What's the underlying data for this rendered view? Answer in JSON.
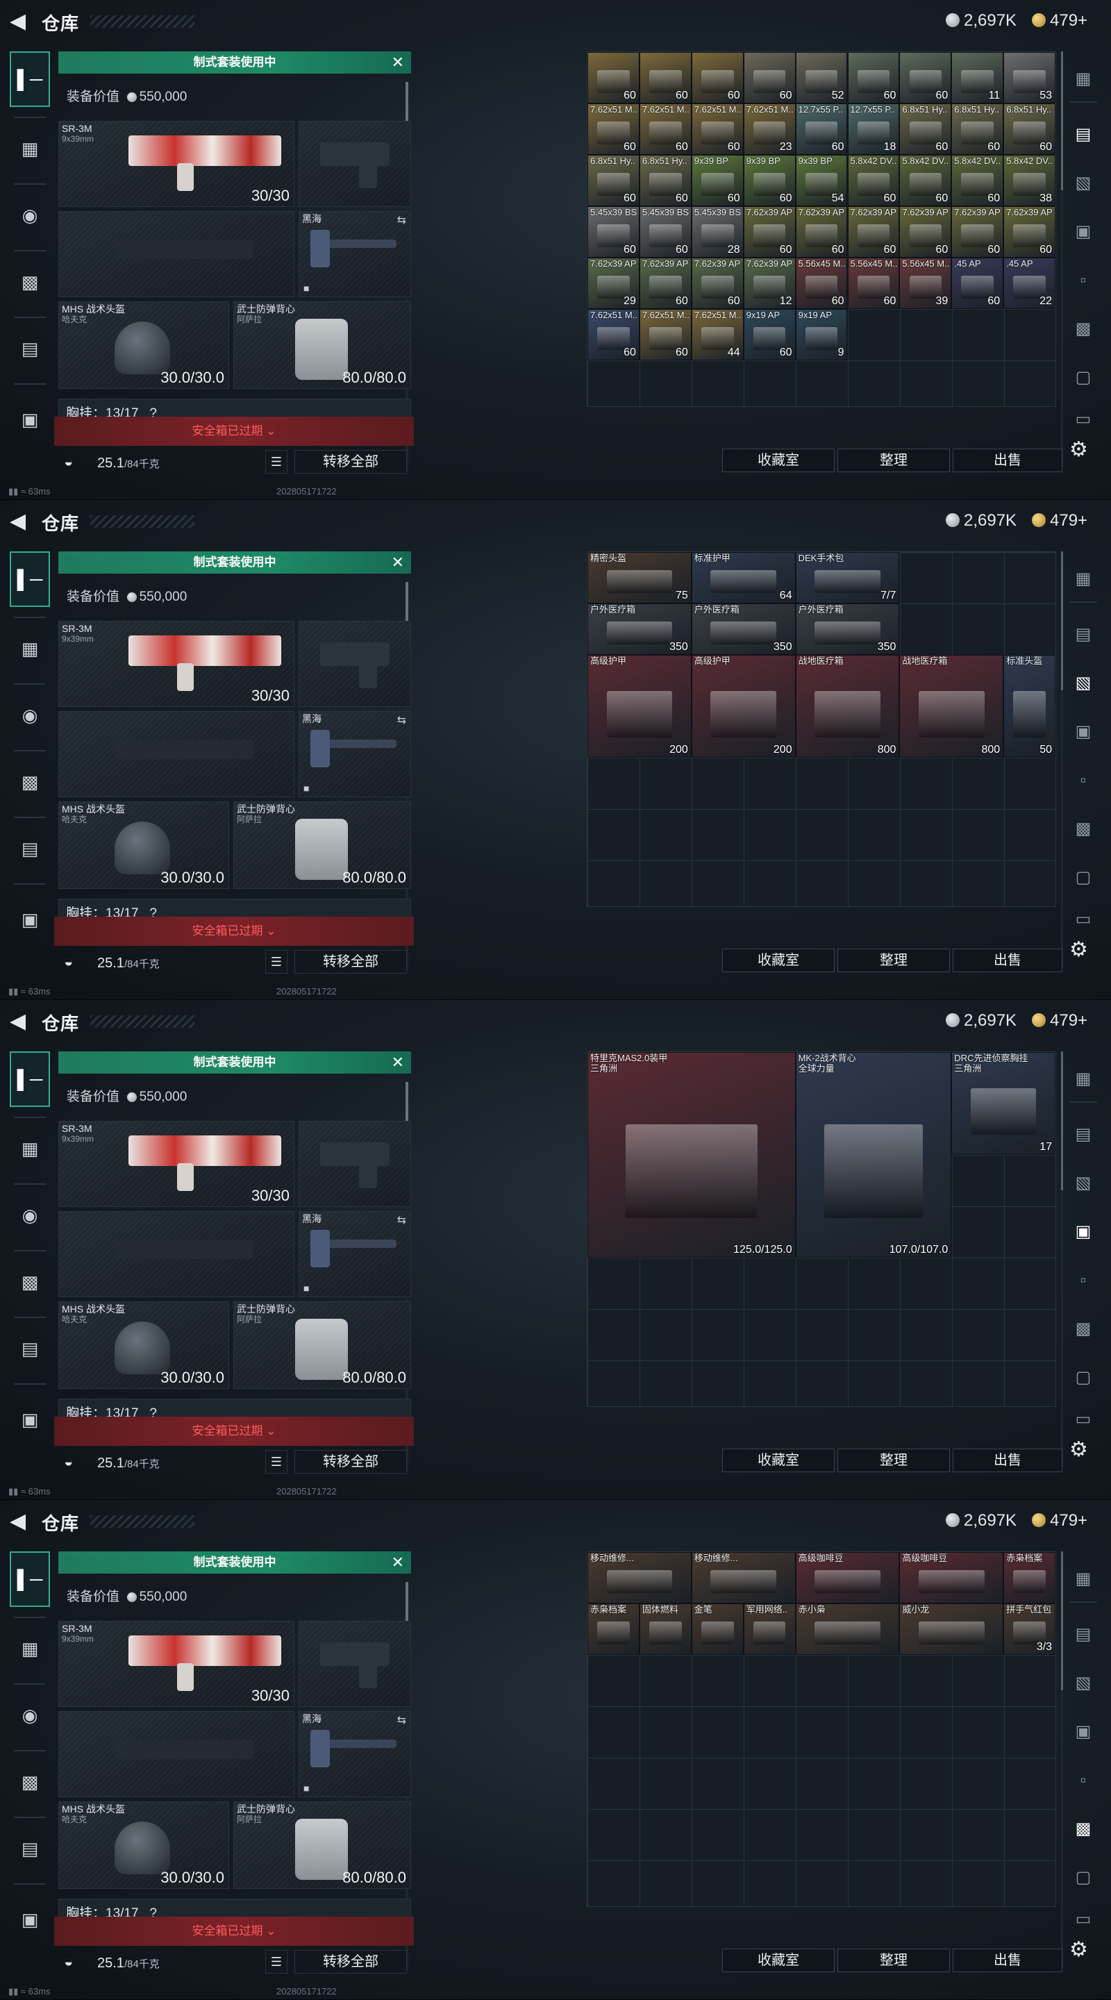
{
  "header": {
    "title": "仓库",
    "silver": "2,697K",
    "gold": "479+",
    "silver_color": "#b9bfc5",
    "gold_color": "#d9b24a"
  },
  "loadout": {
    "banner": "制式套装使用中",
    "equip_value_label": "装备价值",
    "equip_value": "550,000",
    "primary": {
      "name": "SR-3M",
      "caliber": "9x39mm",
      "ammo": "30/30"
    },
    "melee": {
      "name": "黑海"
    },
    "helmet": {
      "name": "MHS 战术头盔",
      "sub": "哈夫克",
      "dur": "30.0/30.0"
    },
    "armor": {
      "name": "武士防弹背心",
      "sub": "阿萨拉",
      "dur": "80.0/80.0"
    },
    "chest": {
      "label": "胸挂：13/17",
      "q": "?"
    },
    "safebox": "安全箱已过期",
    "weight": "25.1",
    "weight_cap": "/84千克",
    "transfer": "转移全部"
  },
  "actions": {
    "collection": "收藏室",
    "sort": "整理",
    "sell": "出售"
  },
  "status": {
    "ping": "63ms",
    "build": "202805171722"
  },
  "icons": {
    "back": "back-arrow-icon",
    "weapon": "gun-icon",
    "armor": "vest-icon",
    "helmet": "helmet-icon",
    "bag": "backpack-icon",
    "pouch": "pouch-icon",
    "case": "case-icon",
    "lock": "lock-icon",
    "list": "list-icon",
    "gear": "gear-icon"
  },
  "panels": [
    {
      "items": [
        {
          "c": 0,
          "r": 0,
          "w": 1,
          "h": 1,
          "name": "",
          "count": "60",
          "color": "#7d6a3a"
        },
        {
          "c": 1,
          "r": 0,
          "w": 1,
          "h": 1,
          "name": "",
          "count": "60",
          "color": "#7d6a3a"
        },
        {
          "c": 2,
          "r": 0,
          "w": 1,
          "h": 1,
          "name": "",
          "count": "60",
          "color": "#7d6a3a"
        },
        {
          "c": 3,
          "r": 0,
          "w": 1,
          "h": 1,
          "name": "",
          "count": "60",
          "color": "#6e6a5a"
        },
        {
          "c": 4,
          "r": 0,
          "w": 1,
          "h": 1,
          "name": "",
          "count": "52",
          "color": "#6e6a5a"
        },
        {
          "c": 5,
          "r": 0,
          "w": 1,
          "h": 1,
          "name": "",
          "count": "60",
          "color": "#5e6a5a"
        },
        {
          "c": 6,
          "r": 0,
          "w": 1,
          "h": 1,
          "name": "",
          "count": "60",
          "color": "#5e6a5a"
        },
        {
          "c": 7,
          "r": 0,
          "w": 1,
          "h": 1,
          "name": "",
          "count": "11",
          "color": "#5e6a5a"
        },
        {
          "c": 8,
          "r": 0,
          "w": 1,
          "h": 1,
          "name": "",
          "count": "53",
          "color": "#6e6e6e"
        },
        {
          "c": 0,
          "r": 1,
          "w": 1,
          "h": 1,
          "name": "7.62x51 M..",
          "count": "60",
          "color": "#7d6a3a"
        },
        {
          "c": 1,
          "r": 1,
          "w": 1,
          "h": 1,
          "name": "7.62x51 M..",
          "count": "60",
          "color": "#7d6a3a"
        },
        {
          "c": 2,
          "r": 1,
          "w": 1,
          "h": 1,
          "name": "7.62x51 M..",
          "count": "60",
          "color": "#7d6a3a"
        },
        {
          "c": 3,
          "r": 1,
          "w": 1,
          "h": 1,
          "name": "7.62x51 M..",
          "count": "23",
          "color": "#7d6a3a"
        },
        {
          "c": 4,
          "r": 1,
          "w": 1,
          "h": 1,
          "name": "12.7x55 P..",
          "count": "60",
          "color": "#4f6a6a"
        },
        {
          "c": 5,
          "r": 1,
          "w": 1,
          "h": 1,
          "name": "12.7x55 P..",
          "count": "18",
          "color": "#4f6a6a"
        },
        {
          "c": 6,
          "r": 1,
          "w": 1,
          "h": 1,
          "name": "6.8x51 Hy..",
          "count": "60",
          "color": "#6e6a4a"
        },
        {
          "c": 7,
          "r": 1,
          "w": 1,
          "h": 1,
          "name": "6.8x51 Hy..",
          "count": "60",
          "color": "#6e6a4a"
        },
        {
          "c": 8,
          "r": 1,
          "w": 1,
          "h": 1,
          "name": "6.8x51 Hy..",
          "count": "60",
          "color": "#6e6a4a"
        },
        {
          "c": 0,
          "r": 2,
          "w": 1,
          "h": 1,
          "name": "6.8x51 Hy..",
          "count": "60",
          "color": "#6e6a4a"
        },
        {
          "c": 1,
          "r": 2,
          "w": 1,
          "h": 1,
          "name": "6.8x51 Hy..",
          "count": "60",
          "color": "#6e6a4a"
        },
        {
          "c": 2,
          "r": 2,
          "w": 1,
          "h": 1,
          "name": "9x39 BP",
          "count": "60",
          "color": "#5e7a3a"
        },
        {
          "c": 3,
          "r": 2,
          "w": 1,
          "h": 1,
          "name": "9x39 BP",
          "count": "60",
          "color": "#5e7a3a"
        },
        {
          "c": 4,
          "r": 2,
          "w": 1,
          "h": 1,
          "name": "9x39 BP",
          "count": "54",
          "color": "#5e7a3a"
        },
        {
          "c": 5,
          "r": 2,
          "w": 1,
          "h": 1,
          "name": "5.8x42 DV..",
          "count": "60",
          "color": "#5e6a3a"
        },
        {
          "c": 6,
          "r": 2,
          "w": 1,
          "h": 1,
          "name": "5.8x42 DV..",
          "count": "60",
          "color": "#5e6a3a"
        },
        {
          "c": 7,
          "r": 2,
          "w": 1,
          "h": 1,
          "name": "5.8x42 DV..",
          "count": "60",
          "color": "#5e6a3a"
        },
        {
          "c": 8,
          "r": 2,
          "w": 1,
          "h": 1,
          "name": "5.8x42 DV..",
          "count": "38",
          "color": "#5e6a3a"
        },
        {
          "c": 0,
          "r": 3,
          "w": 1,
          "h": 1,
          "name": "5.45x39 BS",
          "count": "60",
          "color": "#6e6e6e"
        },
        {
          "c": 1,
          "r": 3,
          "w": 1,
          "h": 1,
          "name": "5.45x39 BS",
          "count": "60",
          "color": "#6e6e6e"
        },
        {
          "c": 2,
          "r": 3,
          "w": 1,
          "h": 1,
          "name": "5.45x39 BS",
          "count": "28",
          "color": "#6e6e6e"
        },
        {
          "c": 3,
          "r": 3,
          "w": 1,
          "h": 1,
          "name": "7.62x39 AP",
          "count": "60",
          "color": "#6a6a3a"
        },
        {
          "c": 4,
          "r": 3,
          "w": 1,
          "h": 1,
          "name": "7.62x39 AP",
          "count": "60",
          "color": "#6a6a3a"
        },
        {
          "c": 5,
          "r": 3,
          "w": 1,
          "h": 1,
          "name": "7.62x39 AP",
          "count": "60",
          "color": "#6a6a3a"
        },
        {
          "c": 6,
          "r": 3,
          "w": 1,
          "h": 1,
          "name": "7.62x39 AP",
          "count": "60",
          "color": "#6a6a3a"
        },
        {
          "c": 7,
          "r": 3,
          "w": 1,
          "h": 1,
          "name": "7.62x39 AP",
          "count": "60",
          "color": "#6a6a3a"
        },
        {
          "c": 8,
          "r": 3,
          "w": 1,
          "h": 1,
          "name": "7.62x39 AP",
          "count": "60",
          "color": "#6a6a3a"
        },
        {
          "c": 0,
          "r": 4,
          "w": 1,
          "h": 1,
          "name": "7.62x39 AP",
          "count": "29",
          "color": "#5a6a4a"
        },
        {
          "c": 1,
          "r": 4,
          "w": 1,
          "h": 1,
          "name": "7.62x39 AP",
          "count": "60",
          "color": "#5a6a4a"
        },
        {
          "c": 2,
          "r": 4,
          "w": 1,
          "h": 1,
          "name": "7.62x39 AP",
          "count": "60",
          "color": "#5a6a4a"
        },
        {
          "c": 3,
          "r": 4,
          "w": 1,
          "h": 1,
          "name": "7.62x39 AP",
          "count": "12",
          "color": "#5a6a4a"
        },
        {
          "c": 4,
          "r": 4,
          "w": 1,
          "h": 1,
          "name": "5.56x45 M..",
          "count": "60",
          "color": "#6a3a3a"
        },
        {
          "c": 5,
          "r": 4,
          "w": 1,
          "h": 1,
          "name": "5.56x45 M..",
          "count": "60",
          "color": "#6a3a3a"
        },
        {
          "c": 6,
          "r": 4,
          "w": 1,
          "h": 1,
          "name": "5.56x45 M..",
          "count": "39",
          "color": "#6a3a3a"
        },
        {
          "c": 7,
          "r": 4,
          "w": 1,
          "h": 1,
          "name": ".45 AP",
          "count": "60",
          "color": "#3a3a5a"
        },
        {
          "c": 8,
          "r": 4,
          "w": 1,
          "h": 1,
          "name": ".45 AP",
          "count": "22",
          "color": "#3a3a5a"
        },
        {
          "c": 0,
          "r": 5,
          "w": 1,
          "h": 1,
          "name": "7.62x51 M..",
          "count": "60",
          "color": "#3a4a6a"
        },
        {
          "c": 1,
          "r": 5,
          "w": 1,
          "h": 1,
          "name": "7.62x51 M..",
          "count": "60",
          "color": "#7d6a3a"
        },
        {
          "c": 2,
          "r": 5,
          "w": 1,
          "h": 1,
          "name": "7.62x51 M..",
          "count": "44",
          "color": "#7d6a3a"
        },
        {
          "c": 3,
          "r": 5,
          "w": 1,
          "h": 1,
          "name": "9x19 AP",
          "count": "60",
          "color": "#2f4a5a"
        },
        {
          "c": 4,
          "r": 5,
          "w": 1,
          "h": 1,
          "name": "9x19 AP",
          "count": "9",
          "color": "#2f4a5a"
        }
      ]
    },
    {
      "items": [
        {
          "c": 0,
          "r": 0,
          "w": 2,
          "h": 1,
          "name": "精密头盔",
          "count": "75",
          "color": "#4a3a2e"
        },
        {
          "c": 2,
          "r": 0,
          "w": 2,
          "h": 1,
          "name": "标准护甲",
          "count": "64",
          "color": "#2e3a4e"
        },
        {
          "c": 4,
          "r": 0,
          "w": 2,
          "h": 1,
          "name": "DEK手术包",
          "count": "7/7",
          "color": "#2e3a4e"
        },
        {
          "c": 0,
          "r": 1,
          "w": 2,
          "h": 1,
          "name": "户外医疗箱",
          "count": "350",
          "color": "#3a3f45"
        },
        {
          "c": 2,
          "r": 1,
          "w": 2,
          "h": 1,
          "name": "户外医疗箱",
          "count": "350",
          "color": "#3a3f45"
        },
        {
          "c": 4,
          "r": 1,
          "w": 2,
          "h": 1,
          "name": "户外医疗箱",
          "count": "350",
          "color": "#3a3f45"
        },
        {
          "c": 0,
          "r": 2,
          "w": 2,
          "h": 2,
          "name": "高级护甲",
          "count": "200",
          "color": "#5a2a32"
        },
        {
          "c": 2,
          "r": 2,
          "w": 2,
          "h": 2,
          "name": "高级护甲",
          "count": "200",
          "color": "#5a2a32"
        },
        {
          "c": 4,
          "r": 2,
          "w": 2,
          "h": 2,
          "name": "战地医疗箱",
          "count": "800",
          "color": "#5a2a32"
        },
        {
          "c": 6,
          "r": 2,
          "w": 2,
          "h": 2,
          "name": "战地医疗箱",
          "count": "800",
          "color": "#5a2a32"
        },
        {
          "c": 8,
          "r": 2,
          "w": 1,
          "h": 2,
          "name": "标准头盔",
          "count": "50",
          "color": "#2e3a4e"
        }
      ]
    },
    {
      "items": [
        {
          "c": 0,
          "r": 0,
          "w": 4,
          "h": 4,
          "name": "特里克MAS2.0装甲",
          "sub": "三角洲",
          "count": "125.0/125.0",
          "color": "#5a2a32"
        },
        {
          "c": 4,
          "r": 0,
          "w": 3,
          "h": 4,
          "name": "MK-2战术背心",
          "sub": "全球力量",
          "count": "107.0/107.0",
          "color": "#2e3a4e"
        },
        {
          "c": 7,
          "r": 0,
          "w": 2,
          "h": 2,
          "name": "DRC先进侦察胸挂",
          "sub": "三角洲",
          "count": "17",
          "color": "#2e3a4e"
        }
      ]
    },
    {
      "items": [
        {
          "c": 0,
          "r": 0,
          "w": 2,
          "h": 1,
          "name": "移动维修...",
          "count": "",
          "color": "#4a3a2e"
        },
        {
          "c": 2,
          "r": 0,
          "w": 2,
          "h": 1,
          "name": "移动维修...",
          "count": "",
          "color": "#4a3a2e"
        },
        {
          "c": 4,
          "r": 0,
          "w": 2,
          "h": 1,
          "name": "高级咖啡豆",
          "count": "",
          "color": "#5a2a32"
        },
        {
          "c": 6,
          "r": 0,
          "w": 2,
          "h": 1,
          "name": "高级咖啡豆",
          "count": "",
          "color": "#5a2a32"
        },
        {
          "c": 8,
          "r": 0,
          "w": 1,
          "h": 1,
          "name": "赤枭档案",
          "count": "",
          "color": "#5a2a32"
        },
        {
          "c": 0,
          "r": 1,
          "w": 1,
          "h": 1,
          "name": "赤枭档案",
          "count": "",
          "color": "#4a3a2e"
        },
        {
          "c": 1,
          "r": 1,
          "w": 1,
          "h": 1,
          "name": "固体燃料",
          "count": "",
          "color": "#4a3a2e"
        },
        {
          "c": 2,
          "r": 1,
          "w": 1,
          "h": 1,
          "name": "金笔",
          "count": "",
          "color": "#4a3a2e"
        },
        {
          "c": 3,
          "r": 1,
          "w": 1,
          "h": 1,
          "name": "军用网络..",
          "count": "",
          "color": "#4a3a2e"
        },
        {
          "c": 4,
          "r": 1,
          "w": 2,
          "h": 1,
          "name": "赤小枭",
          "count": "",
          "color": "#4a3a2e"
        },
        {
          "c": 6,
          "r": 1,
          "w": 2,
          "h": 1,
          "name": "威小龙",
          "count": "",
          "color": "#4a3a2e"
        },
        {
          "c": 8,
          "r": 1,
          "w": 1,
          "h": 1,
          "name": "拼手气红包",
          "count": "3/3",
          "color": "#4a3a2e"
        }
      ]
    }
  ]
}
